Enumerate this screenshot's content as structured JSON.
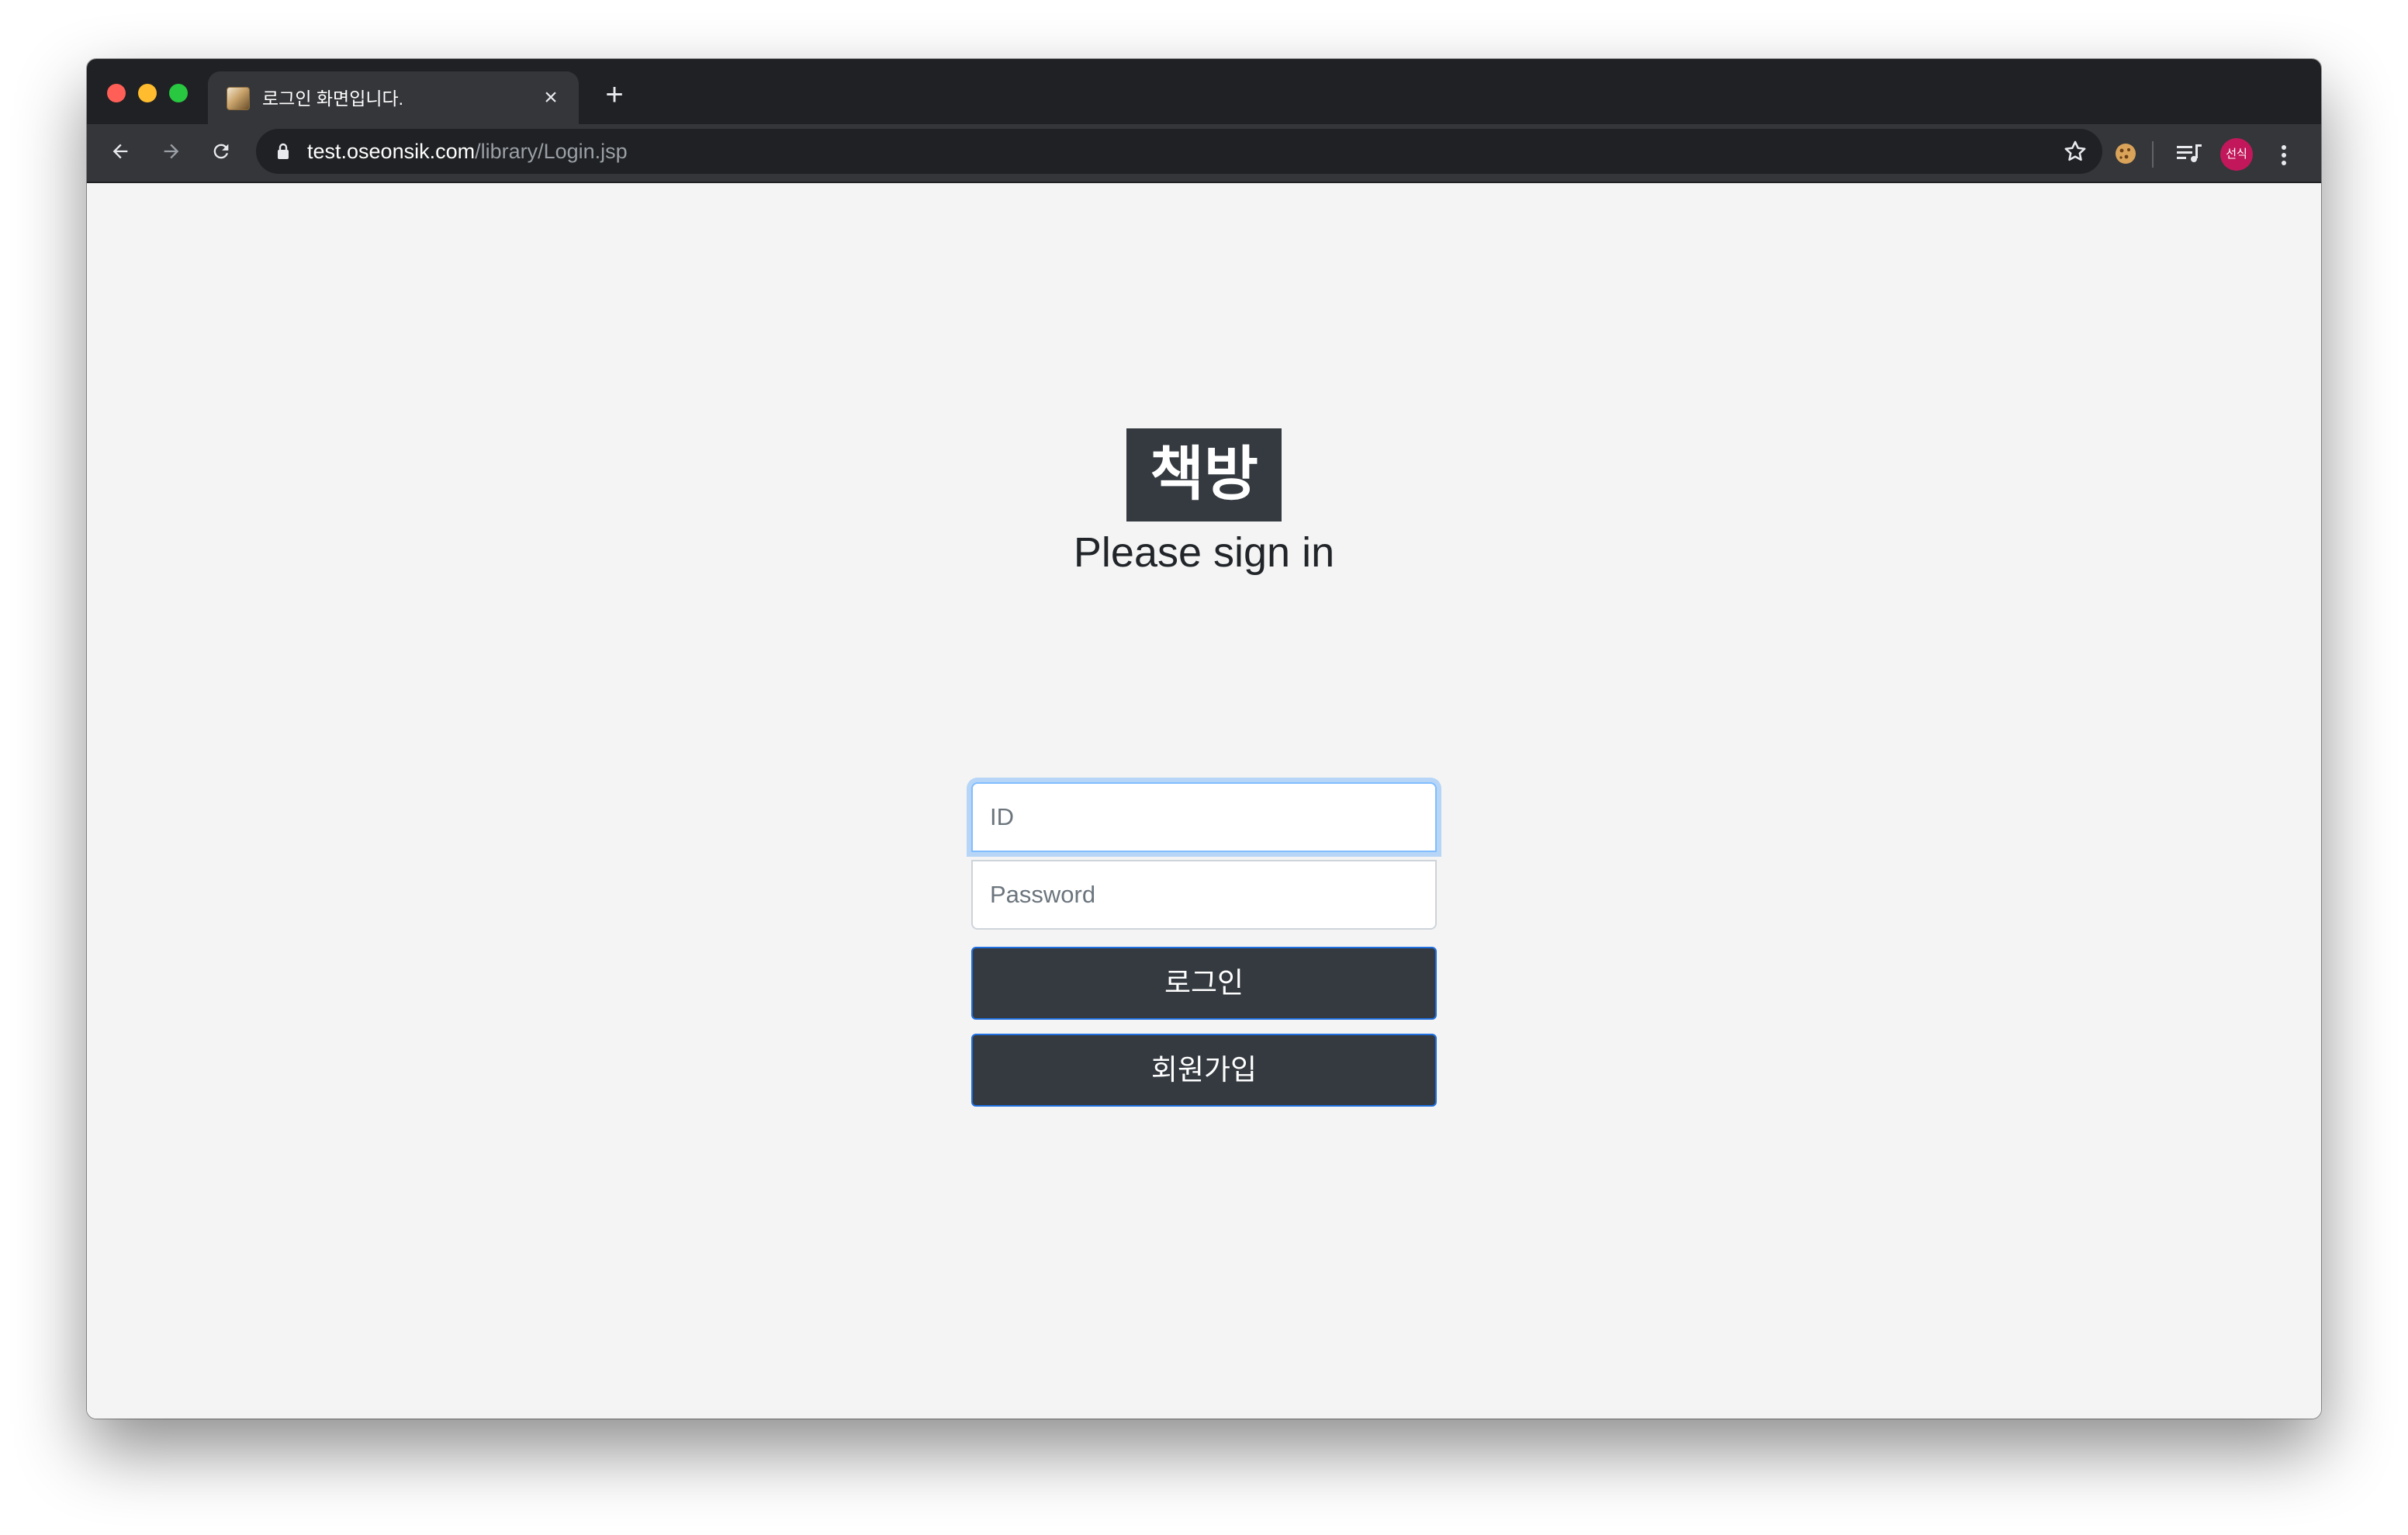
{
  "browser": {
    "tab": {
      "title": "로그인 화면입니다.",
      "close_label": "×"
    },
    "new_tab_label": "+",
    "address_bar": {
      "host": "test.oseonsik.com",
      "path": "/library/Login.jsp"
    },
    "profile_avatar_text": "선식"
  },
  "page": {
    "logo_text": "책방",
    "heading": "Please sign in",
    "id_field": {
      "placeholder": "ID",
      "value": ""
    },
    "password_field": {
      "placeholder": "Password",
      "value": ""
    },
    "login_button_label": "로그인",
    "signup_button_label": "회원가입"
  },
  "colors": {
    "page_background": "#f4f4f4",
    "brand_dark": "#343a40",
    "focus_ring": "#80bdff",
    "button_border": "#1f6fe0"
  }
}
